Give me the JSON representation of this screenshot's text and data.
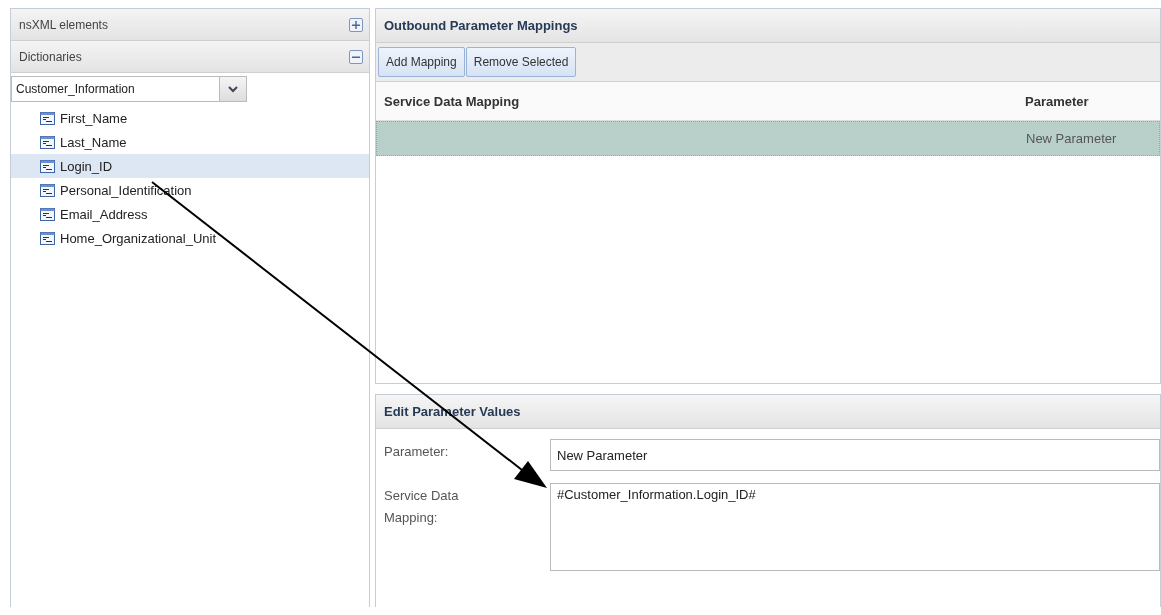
{
  "sidebar": {
    "sections": [
      {
        "title": "nsXML elements",
        "expanded": false
      },
      {
        "title": "Dictionaries",
        "expanded": true
      }
    ],
    "dictionary_select": {
      "value": "Customer_Information"
    },
    "items": [
      {
        "label": "First_Name",
        "selected": false
      },
      {
        "label": "Last_Name",
        "selected": false
      },
      {
        "label": "Login_ID",
        "selected": true
      },
      {
        "label": "Personal_Identification",
        "selected": false
      },
      {
        "label": "Email_Address",
        "selected": false
      },
      {
        "label": "Home_Organizational_Unit",
        "selected": false
      }
    ]
  },
  "mappings_panel": {
    "title": "Outbound Parameter Mappings",
    "buttons": [
      "Add Mapping",
      "Remove Selected"
    ],
    "table": {
      "columns": [
        "Service Data Mapping",
        "Parameter"
      ],
      "rows": [
        {
          "parameter": "New Parameter",
          "selected": true
        }
      ]
    }
  },
  "edit_panel": {
    "title": "Edit Parameter Values",
    "fields": [
      {
        "kind": "text",
        "label": "Parameter:",
        "value": "New Parameter"
      },
      {
        "kind": "textarea",
        "label": "Service Data Mapping:",
        "value": "#Customer_Information.Login_ID#"
      }
    ]
  }
}
